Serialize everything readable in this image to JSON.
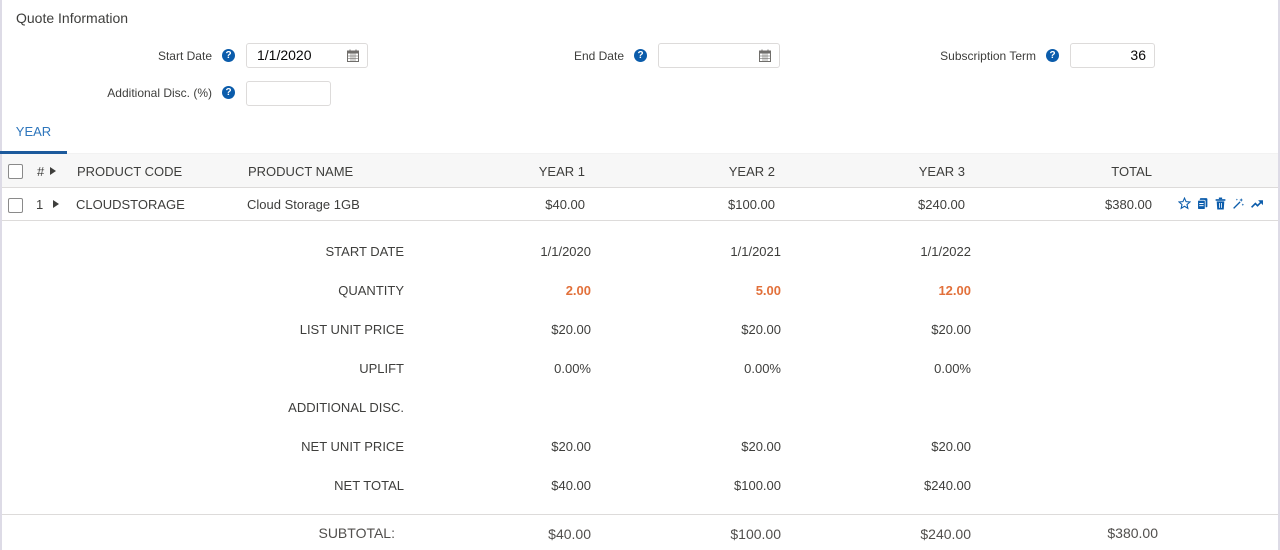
{
  "section": {
    "title": "Quote Information"
  },
  "fields": {
    "start_date": {
      "label": "Start Date",
      "value": "1/1/2020",
      "icon": "calendar-icon"
    },
    "end_date": {
      "label": "End Date",
      "value": "",
      "icon": "calendar-icon"
    },
    "subscription_term": {
      "label": "Subscription Term",
      "value": "36"
    },
    "additional_disc": {
      "label": "Additional Disc. (%)",
      "value": ""
    },
    "help_glyph": "?"
  },
  "tabs": [
    {
      "label": "YEAR",
      "active": true
    }
  ],
  "table": {
    "headers": {
      "number": "#",
      "product_code": "PRODUCT CODE",
      "product_name": "PRODUCT NAME",
      "year1": "YEAR 1",
      "year2": "YEAR 2",
      "year3": "YEAR 3",
      "total": "TOTAL"
    },
    "rows": [
      {
        "number": "1",
        "product_code": "CLOUDSTORAGE",
        "product_name": "Cloud Storage 1GB",
        "year1": "$40.00",
        "year2": "$100.00",
        "year3": "$240.00",
        "total": "$380.00",
        "actions": [
          "star-icon",
          "clone-icon",
          "delete-icon",
          "magic-wand-icon",
          "trend-icon"
        ]
      }
    ]
  },
  "details": {
    "rows": [
      {
        "label": "START DATE",
        "values": [
          "1/1/2020",
          "1/1/2021",
          "1/1/2022"
        ]
      },
      {
        "label": "QUANTITY",
        "values": [
          "2.00",
          "5.00",
          "12.00"
        ],
        "highlight": true
      },
      {
        "label": "LIST UNIT PRICE",
        "values": [
          "$20.00",
          "$20.00",
          "$20.00"
        ]
      },
      {
        "label": "UPLIFT",
        "values": [
          "0.00%",
          "0.00%",
          "0.00%"
        ]
      },
      {
        "label": "ADDITIONAL DISC.",
        "values": [
          "",
          "",
          ""
        ]
      },
      {
        "label": "NET UNIT PRICE",
        "values": [
          "$20.00",
          "$20.00",
          "$20.00"
        ]
      },
      {
        "label": "NET TOTAL",
        "values": [
          "$40.00",
          "$100.00",
          "$240.00"
        ]
      }
    ]
  },
  "subtotal": {
    "label": "SUBTOTAL:",
    "year1": "$40.00",
    "year2": "$100.00",
    "year3": "$240.00",
    "total": "$380.00"
  },
  "colors": {
    "accent": "#0b5cab",
    "tab_text": "#2e76bc",
    "quantity": "#e2703a"
  }
}
